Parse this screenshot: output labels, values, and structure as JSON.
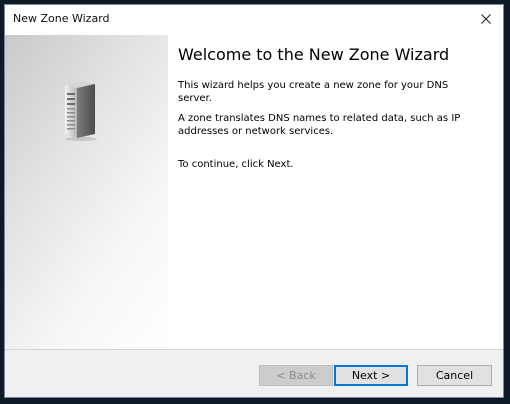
{
  "window": {
    "title": "New Zone Wizard",
    "close_label": "×"
  },
  "content": {
    "heading": "Welcome to the New Zone Wizard",
    "paragraph1": "This wizard helps you create a new zone for your DNS server.",
    "paragraph2": "A zone translates DNS names to related data, such as IP addresses or network services.",
    "paragraph3": "To continue, click Next."
  },
  "buttons": {
    "back": {
      "label": "< Back",
      "enabled": false
    },
    "next": {
      "label": "Next >",
      "enabled": true,
      "default": true
    },
    "cancel": {
      "label": "Cancel",
      "enabled": true
    }
  },
  "icons": {
    "banner": "server-icon",
    "close": "close-icon"
  },
  "colors": {
    "focus_border": "#0078d7",
    "footer_background": "#f0f0f0"
  }
}
